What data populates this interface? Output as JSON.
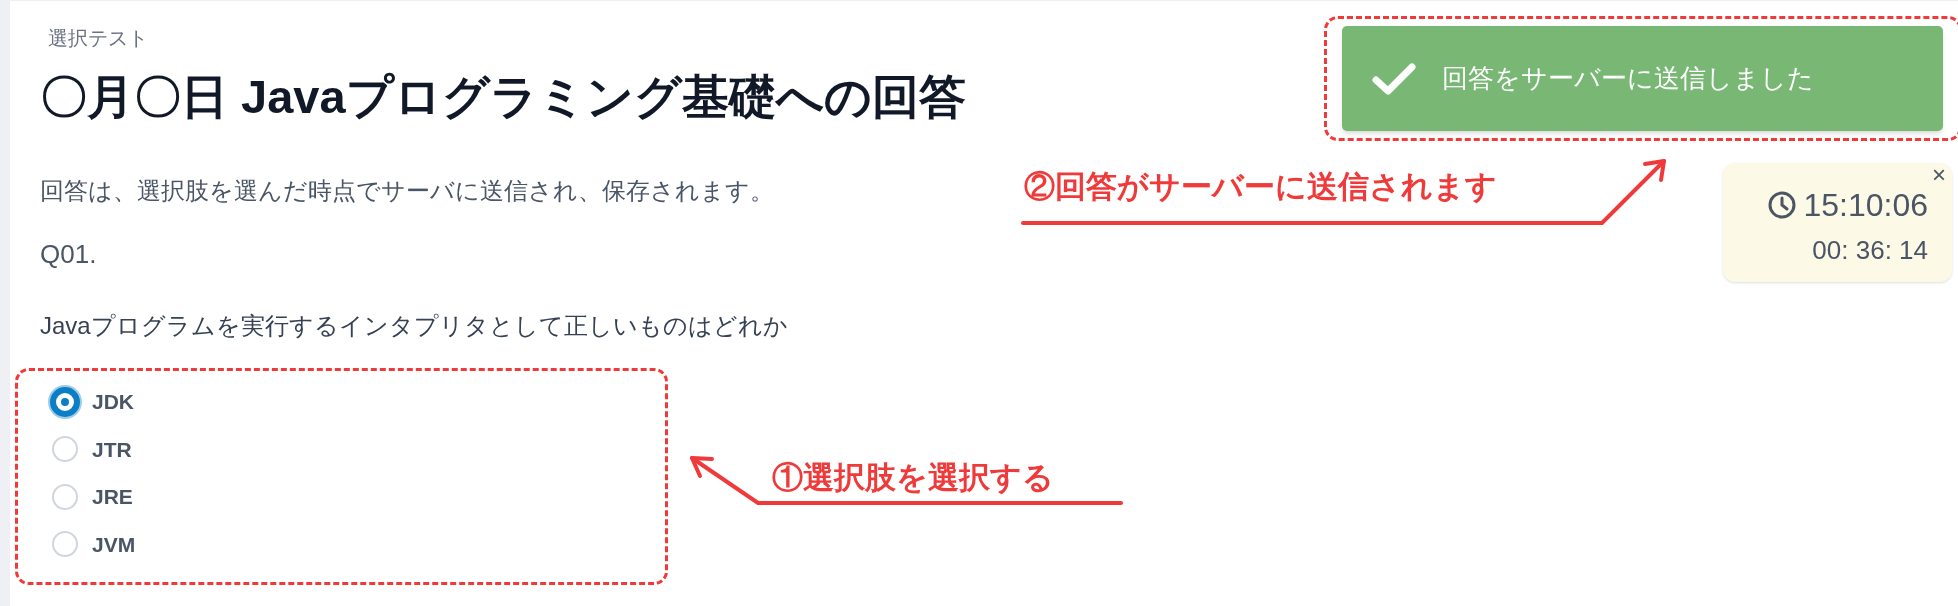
{
  "breadcrumb": "選択テスト",
  "title": "〇月〇日 Javaプログラミング基礎への回答",
  "description": "回答は、選択肢を選んだ時点でサーバに送信され、保存されます。",
  "question": {
    "number": "Q01.",
    "text": "Javaプログラムを実行するインタプリタとして正しいものはどれか",
    "options": [
      {
        "label": "JDK",
        "selected": true
      },
      {
        "label": "JTR",
        "selected": false
      },
      {
        "label": "JRE",
        "selected": false
      },
      {
        "label": "JVM",
        "selected": false
      }
    ]
  },
  "toast": {
    "message": "回答をサーバーに送信しました"
  },
  "timer": {
    "clock": "15:10:06",
    "elapsed": "00: 36: 14",
    "close": "×"
  },
  "annotations": [
    {
      "text": "①選択肢を選択する"
    },
    {
      "text": "②回答がサーバーに送信されます"
    }
  ]
}
